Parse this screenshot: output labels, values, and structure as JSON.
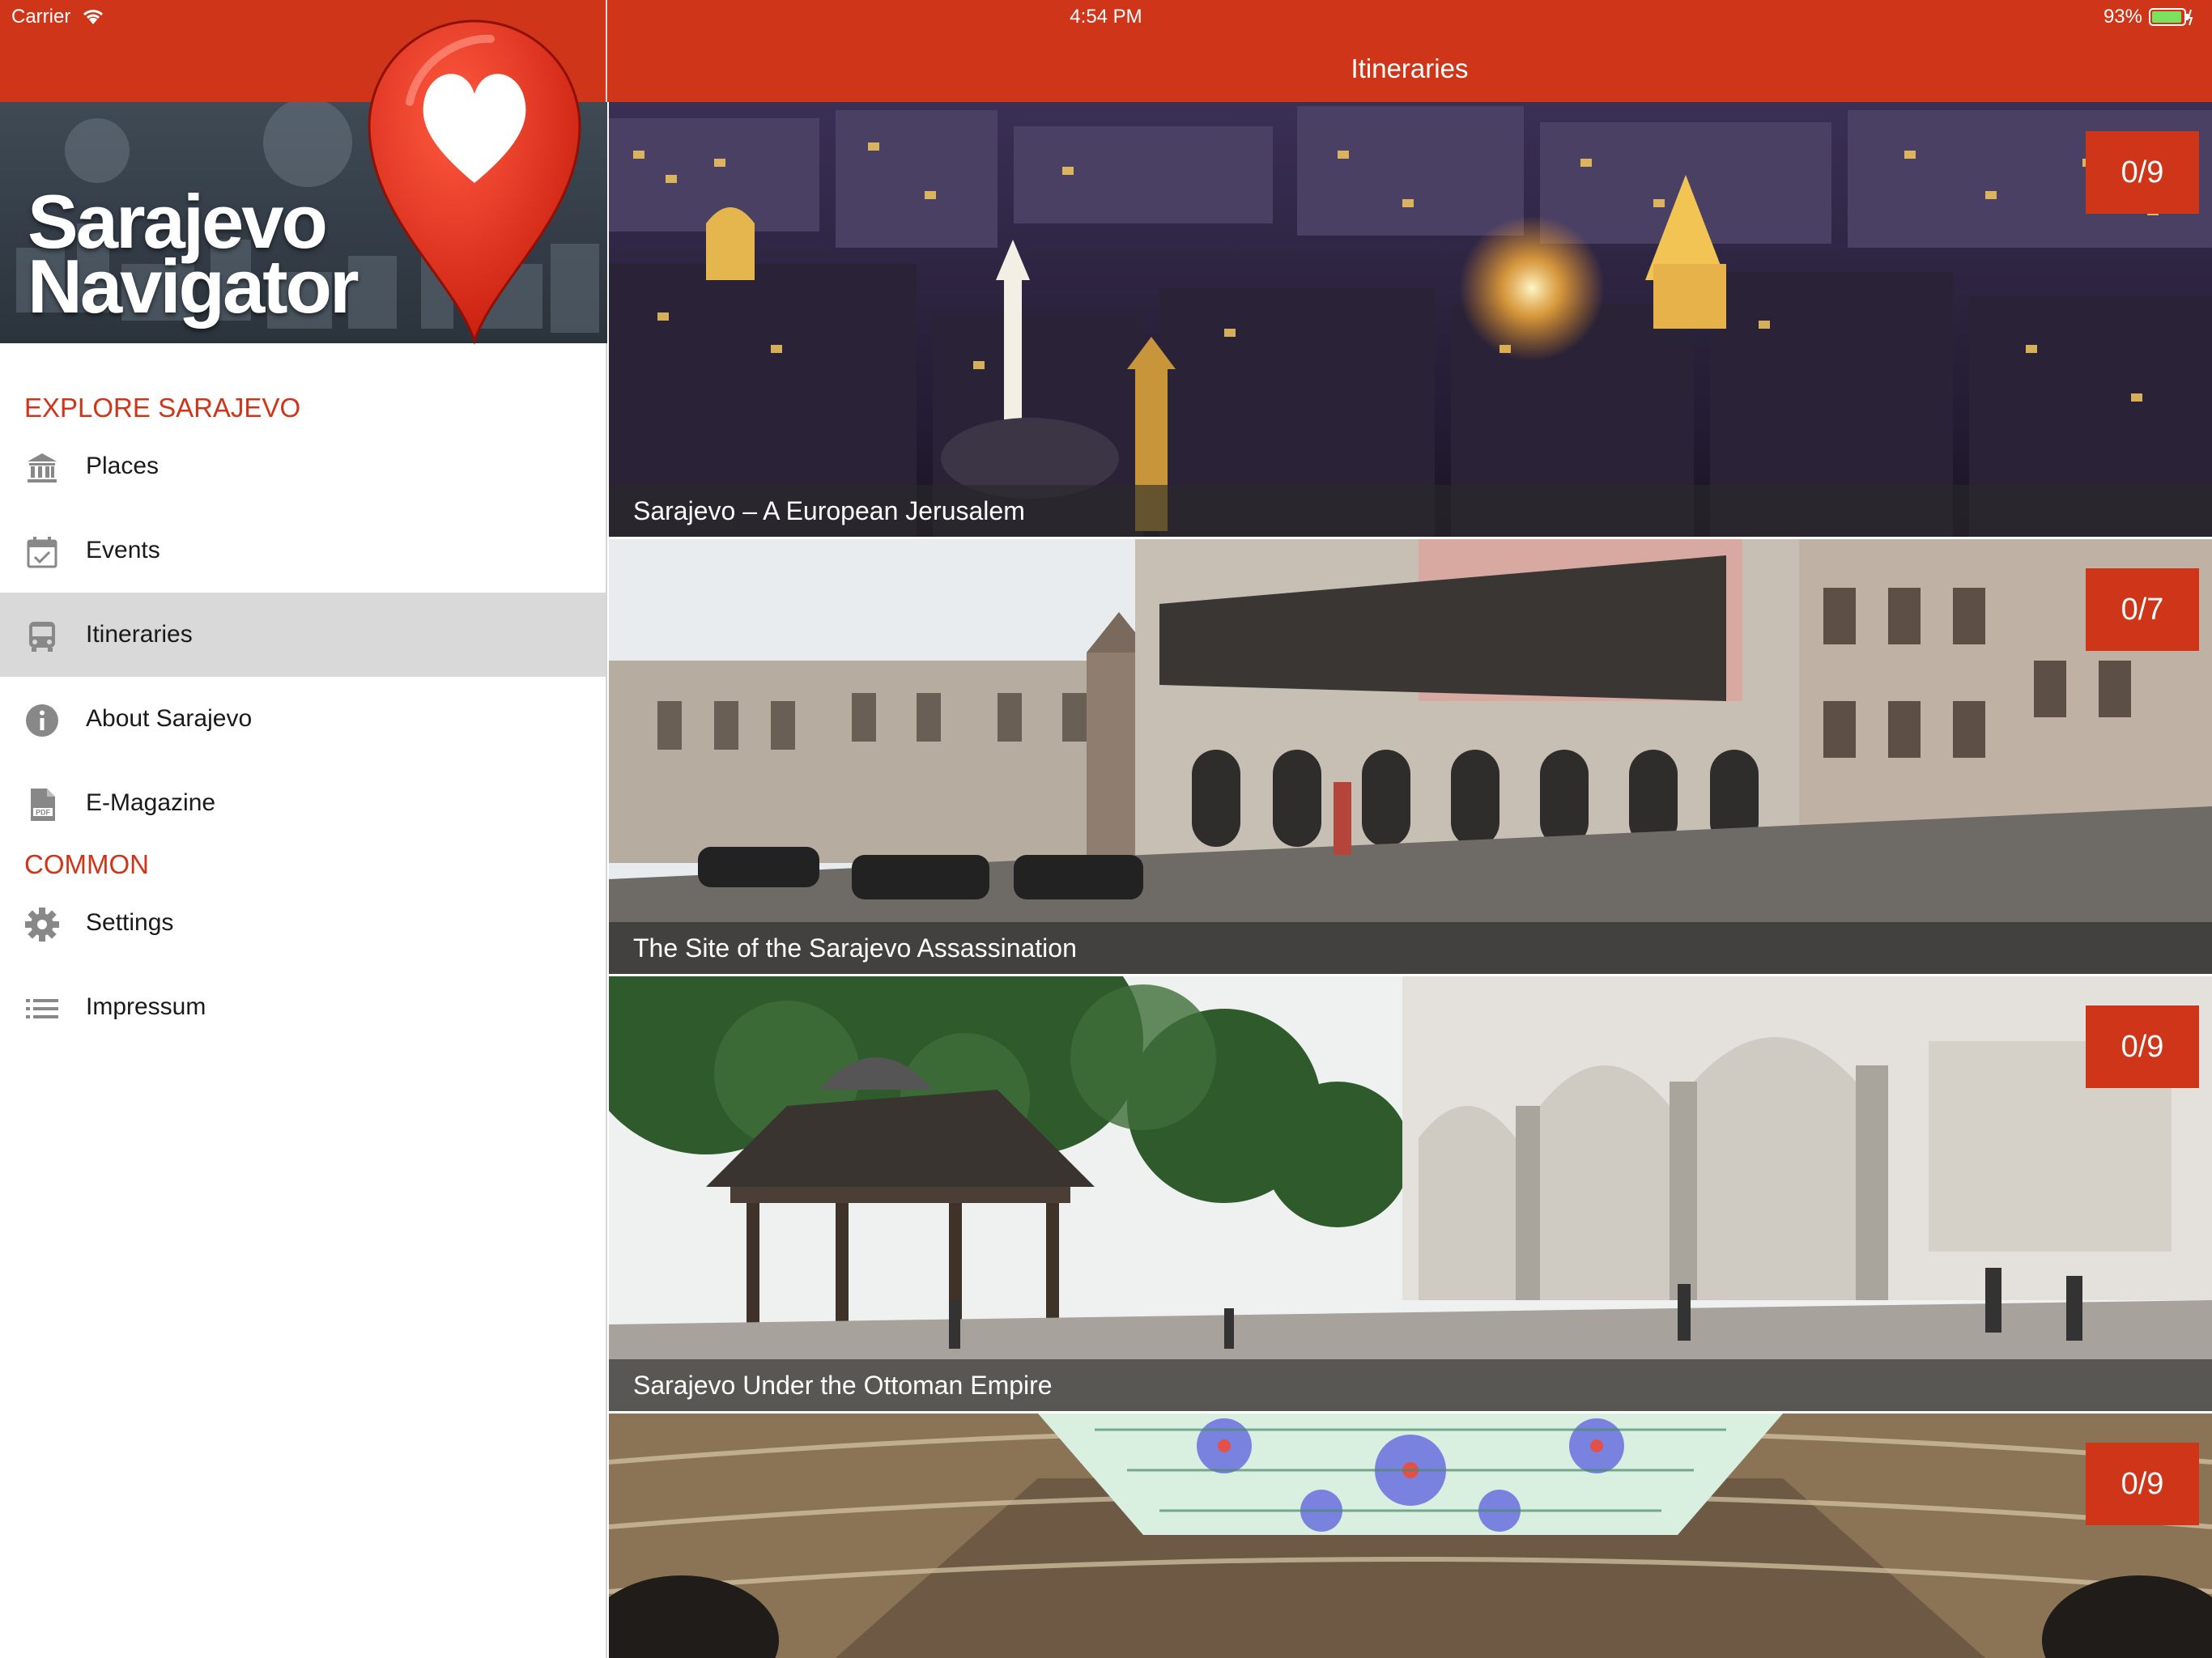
{
  "status_bar": {
    "carrier": "Carrier",
    "time": "4:54 PM",
    "battery_percent": "93%"
  },
  "header": {
    "title": "Itineraries"
  },
  "brand": {
    "logo_line1": "Sarajevo",
    "logo_line2": "Navigator",
    "pin_icon": "heart-location-pin-icon"
  },
  "sidebar": {
    "explore_header": "EXPLORE SARAJEVO",
    "common_header": "COMMON",
    "items": [
      {
        "label": "Places",
        "icon": "building-icon",
        "active": false
      },
      {
        "label": "Events",
        "icon": "calendar-check-icon",
        "active": false
      },
      {
        "label": "Itineraries",
        "icon": "bus-icon",
        "active": true
      },
      {
        "label": "About Sarajevo",
        "icon": "info-icon",
        "active": false
      },
      {
        "label": "E-Magazine",
        "icon": "pdf-icon",
        "active": false
      },
      {
        "label": "Settings",
        "icon": "gear-icon",
        "active": false
      },
      {
        "label": "Impressum",
        "icon": "list-icon",
        "active": false
      }
    ]
  },
  "itineraries": [
    {
      "title": "Sarajevo – A European Jerusalem",
      "progress": "0/9"
    },
    {
      "title": "The Site of the Sarajevo Assassination",
      "progress": "0/7"
    },
    {
      "title": "Sarajevo Under the Ottoman Empire",
      "progress": "0/9"
    },
    {
      "title": "",
      "progress": "0/9"
    }
  ],
  "colors": {
    "accent": "#cf3518",
    "active_item_bg": "#d9d9d9",
    "section_header": "#cf3518"
  }
}
